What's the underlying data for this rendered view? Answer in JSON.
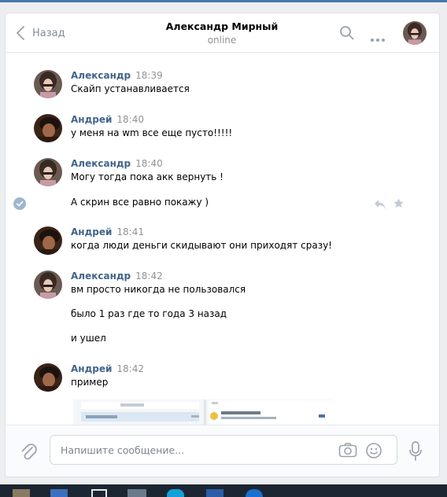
{
  "header": {
    "back_label": "Назад",
    "peer_name": "Александр Мирный",
    "peer_status": "online"
  },
  "messages": [
    {
      "author": "Александр",
      "time": "18:39",
      "lines": [
        "Скайп устанавливается"
      ]
    },
    {
      "author": "Андрей",
      "time": "18:40",
      "lines": [
        "у меня на wm все еще пусто!!!!!"
      ]
    },
    {
      "author": "Александр",
      "time": "18:40",
      "lines": [
        "Могу тогда пока акк вернуть !",
        "А скрин все равно покажу )"
      ]
    },
    {
      "author": "Андрей",
      "time": "18:41",
      "lines": [
        "когда люди деньги скидывают они приходят сразу!"
      ]
    },
    {
      "author": "Александр",
      "time": "18:42",
      "lines": [
        "вм просто никогда не пользовался",
        "было 1 раз где то года 3 назад",
        "и ушел"
      ]
    },
    {
      "author": "Андрей",
      "time": "18:42",
      "lines": [
        "пример"
      ]
    }
  ],
  "composer": {
    "placeholder": "Напишите сообщение..."
  },
  "icons": {
    "back": "chevron-left-icon",
    "search": "search-icon",
    "more": "more-dots-icon",
    "read": "check-circle-icon",
    "reply": "reply-icon",
    "favorite": "star-icon",
    "attach": "paperclip-icon",
    "camera": "camera-icon",
    "emoji": "smile-icon",
    "voice": "microphone-icon"
  },
  "colors": {
    "accent": "#4a76a8",
    "author": "#42648b",
    "muted": "#939393"
  }
}
